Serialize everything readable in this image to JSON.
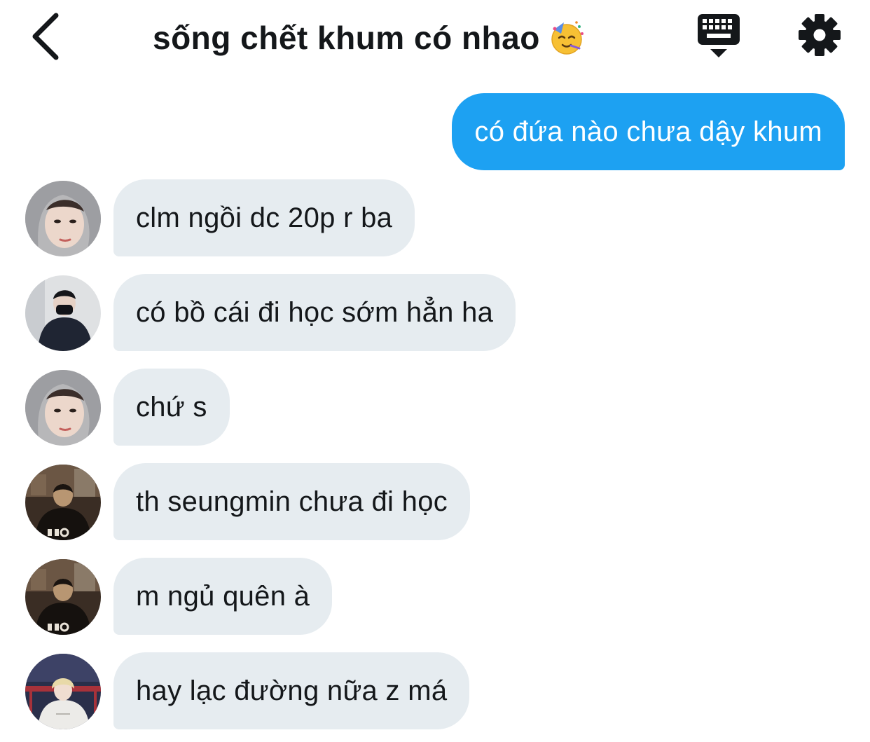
{
  "header": {
    "title": "sống chết khum có nhao",
    "title_emoji": "partying-face",
    "back_icon": "chevron-left-icon",
    "keyboard_icon": "keyboard-icon",
    "settings_icon": "gear-icon"
  },
  "colors": {
    "outgoing_bubble": "#1da1f2",
    "incoming_bubble": "#e6ecf0",
    "text": "#14171a"
  },
  "messages": [
    {
      "direction": "outgoing",
      "text": "có đứa nào chưa dậy khum"
    },
    {
      "direction": "incoming",
      "avatar": "avatar-gray-hoodie",
      "text": "clm ngồi dc 20p r ba"
    },
    {
      "direction": "incoming",
      "avatar": "avatar-black-jacket-mask",
      "text": "có bồ cái đi học sớm hẳn ha"
    },
    {
      "direction": "incoming",
      "avatar": "avatar-gray-hoodie",
      "text": "chứ s"
    },
    {
      "direction": "incoming",
      "avatar": "avatar-dark-street",
      "text": "th seungmin chưa đi học"
    },
    {
      "direction": "incoming",
      "avatar": "avatar-dark-street",
      "text": "m ngủ quên à"
    },
    {
      "direction": "incoming",
      "avatar": "avatar-white-hoodie-blond",
      "text": "hay lạc đường nữa z má"
    }
  ]
}
